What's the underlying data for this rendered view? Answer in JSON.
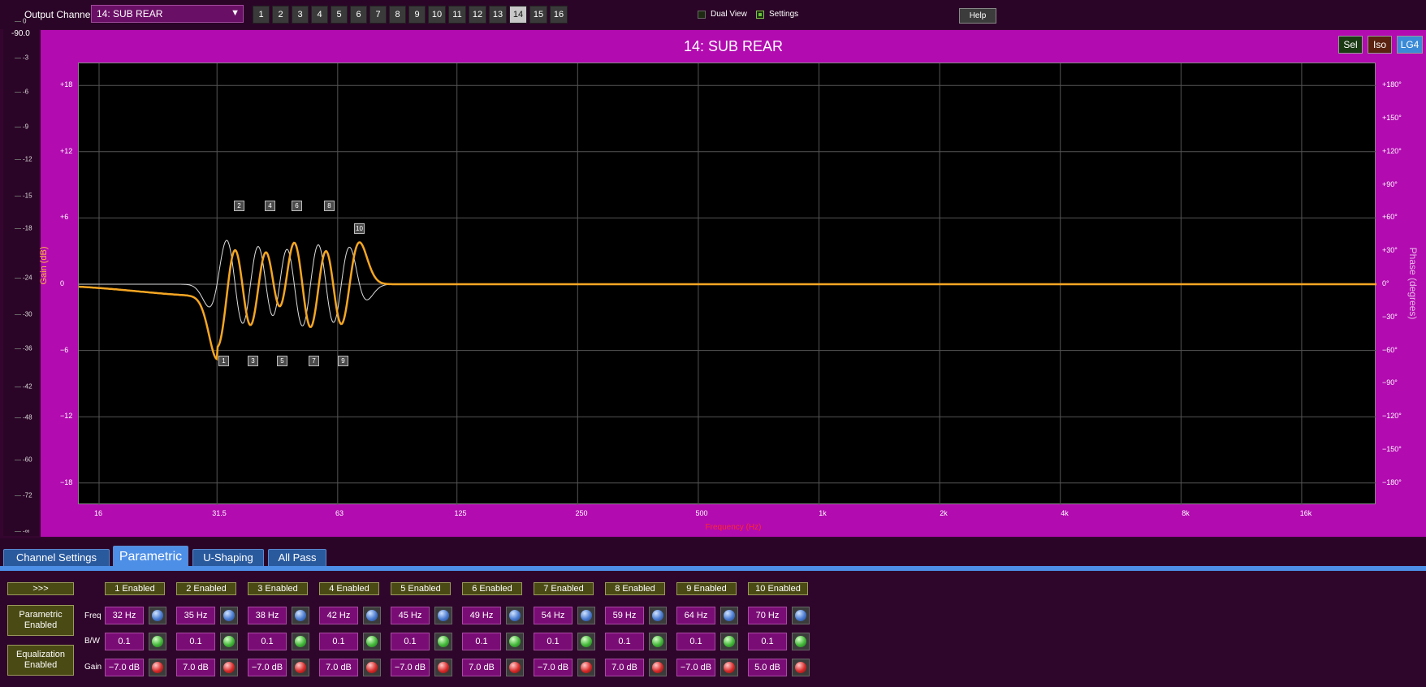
{
  "header": {
    "output_channel_label": "Output Channel:",
    "output_channel_value": "14: SUB REAR",
    "dropdown_arrow": "▼",
    "channels": [
      "1",
      "2",
      "3",
      "4",
      "5",
      "6",
      "7",
      "8",
      "9",
      "10",
      "11",
      "12",
      "13",
      "14",
      "15",
      "16"
    ],
    "active_channel": "14",
    "dual_view_label": "Dual View",
    "settings_label": "Settings",
    "help_label": "Help"
  },
  "meter": {
    "top_value": "-90.0",
    "ticks": [
      "0",
      "-3",
      "-6",
      "-9",
      "-12",
      "-15",
      "-18",
      "-24",
      "-30",
      "-36",
      "-42",
      "-48",
      "-60",
      "-72",
      "-∞"
    ]
  },
  "graph": {
    "title": "14: SUB REAR",
    "sel_label": "Sel",
    "iso_label": "Iso",
    "lg4_label": "LG4",
    "y_axis_label": "Gain (dB)",
    "phase_axis_label": "Phase (degrees)",
    "x_axis_label": "Frequency (Hz)",
    "y_major_ticks": [
      "+18",
      "+12",
      "+6",
      "0",
      "−6",
      "−12",
      "−18"
    ],
    "phase_ticks": [
      "+180°",
      "+150°",
      "+120°",
      "+90°",
      "+60°",
      "+30°",
      "0°",
      "−30°",
      "−60°",
      "−90°",
      "−120°",
      "−150°",
      "−180°"
    ],
    "x_ticks": [
      "16",
      "31.5",
      "63",
      "125",
      "250",
      "500",
      "1k",
      "2k",
      "4k",
      "8k",
      "16k"
    ],
    "band_labels_top": [
      "2",
      "4",
      "6",
      "8",
      "10"
    ],
    "band_labels_bottom": [
      "1",
      "3",
      "5",
      "7",
      "9"
    ],
    "gain_color": "#f5a623",
    "phase_color": "#dddddd"
  },
  "tabs": {
    "channel_settings": "Channel Settings",
    "parametric": "Parametric",
    "u_shaping": "U-Shaping",
    "all_pass": "All Pass"
  },
  "controls": {
    "expand_label": ">>>",
    "parametric_enabled": "Parametric Enabled",
    "equalization_enabled": "Equalization Enabled",
    "freq_label": "Freq",
    "bw_label": "B/W",
    "gain_label": "Gain",
    "bands": [
      {
        "enabled": "1 Enabled",
        "freq": "32 Hz",
        "bw": "0.1",
        "gain": "−7.0 dB"
      },
      {
        "enabled": "2 Enabled",
        "freq": "35 Hz",
        "bw": "0.1",
        "gain": "7.0 dB"
      },
      {
        "enabled": "3 Enabled",
        "freq": "38 Hz",
        "bw": "0.1",
        "gain": "−7.0 dB"
      },
      {
        "enabled": "4 Enabled",
        "freq": "42 Hz",
        "bw": "0.1",
        "gain": "7.0 dB"
      },
      {
        "enabled": "5 Enabled",
        "freq": "45 Hz",
        "bw": "0.1",
        "gain": "−7.0 dB"
      },
      {
        "enabled": "6 Enabled",
        "freq": "49 Hz",
        "bw": "0.1",
        "gain": "7.0 dB"
      },
      {
        "enabled": "7 Enabled",
        "freq": "54 Hz",
        "bw": "0.1",
        "gain": "−7.0 dB"
      },
      {
        "enabled": "8 Enabled",
        "freq": "59 Hz",
        "bw": "0.1",
        "gain": "7.0 dB"
      },
      {
        "enabled": "9 Enabled",
        "freq": "64 Hz",
        "bw": "0.1",
        "gain": "−7.0 dB"
      },
      {
        "enabled": "10 Enabled",
        "freq": "70 Hz",
        "bw": "0.1",
        "gain": "5.0 dB"
      }
    ]
  }
}
